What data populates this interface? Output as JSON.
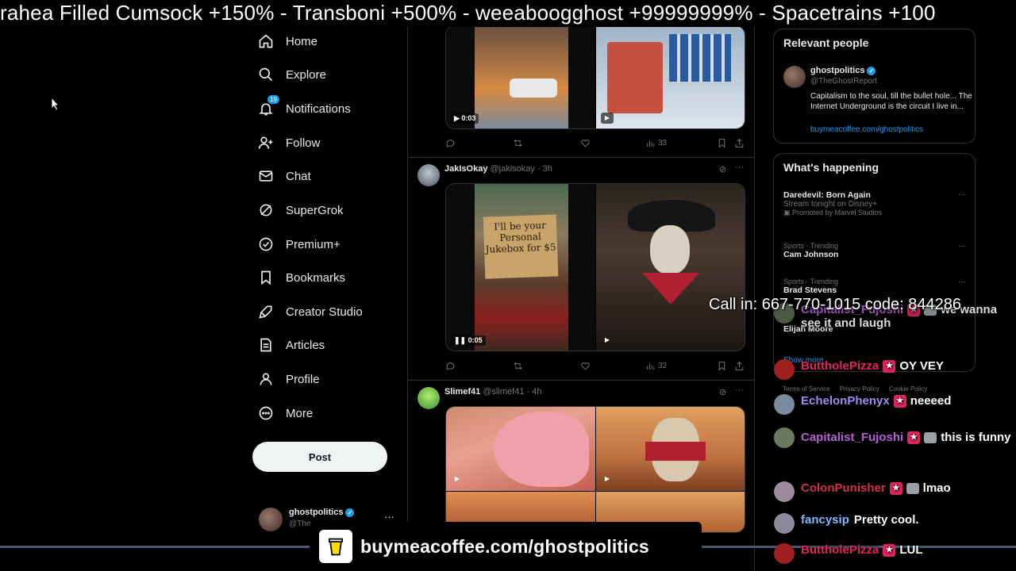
{
  "ticker": {
    "text": "rahea Filled Cumsock +150%  -  Transboni +500%  -  weeaboogghost +99999999%  -  Spacetrains +100"
  },
  "nav": {
    "items": [
      {
        "label": "Home",
        "icon": "home-icon"
      },
      {
        "label": "Explore",
        "icon": "search-icon"
      },
      {
        "label": "Notifications",
        "icon": "bell-icon",
        "badge": "19"
      },
      {
        "label": "Follow",
        "icon": "person-add-icon"
      },
      {
        "label": "Chat",
        "icon": "envelope-icon"
      },
      {
        "label": "SuperGrok",
        "icon": "grok-icon"
      },
      {
        "label": "Premium+",
        "icon": "verified-icon"
      },
      {
        "label": "Bookmarks",
        "icon": "bookmark-icon"
      },
      {
        "label": "Creator Studio",
        "icon": "rocket-icon"
      },
      {
        "label": "Articles",
        "icon": "document-icon"
      },
      {
        "label": "Profile",
        "icon": "person-icon"
      },
      {
        "label": "More",
        "icon": "more-circle-icon"
      }
    ],
    "post_label": "Post"
  },
  "account": {
    "name": "ghostpolitics",
    "handle": "@The",
    "more": "···"
  },
  "feed": {
    "tweets": [
      {
        "video_time": "0:03",
        "actions": {
          "views": "33"
        }
      },
      {
        "name": "JakIsOkay",
        "meta": "@jakisokay · 3h",
        "sign_text": "I'll be your Personal Jukebox for $5",
        "video_time": "0:05",
        "actions": {
          "views": "32"
        }
      },
      {
        "name": "Slimef41",
        "meta": "@slimef41 · 4h"
      }
    ]
  },
  "relevant": {
    "title": "Relevant people",
    "name": "ghostpolitics",
    "handle": "@TheGhostReport",
    "bio": "Capitalism to the soul, till the bullet hole... The Internet Underground is the circuit I live in...",
    "link": "buymeacoffee.com/ghostpolitics"
  },
  "happening": {
    "title": "What's happening",
    "trends": [
      {
        "title": "Daredevil: Born Again",
        "sub": "Stream tonight on Disney+",
        "promo": "Promoted by Marvel Studios"
      },
      {
        "context": "Sports · Trending",
        "title": "Cam Johnson"
      },
      {
        "context": "Sports · Trending",
        "title": "Brad Stevens"
      },
      {
        "title": "Elijah Moore"
      }
    ],
    "show_more": "Show more"
  },
  "footer": [
    "Terms of Service",
    "Privacy Policy",
    "Cookie Policy"
  ],
  "overlay": {
    "callin": "Call in: 667-770-1015 code: 844286",
    "chat": [
      {
        "user": "Capitalist_Fujoshi",
        "color": "#b65fd3",
        "text": "we wanna see it and laugh",
        "partial": true
      },
      {
        "user": "ButtholePizza",
        "color": "#e0245e",
        "text": "OY VEY"
      },
      {
        "user": "EchelonPhenyx",
        "color": "#9b8cf0",
        "text": "neeeed"
      },
      {
        "user": "Capitalist_Fujoshi",
        "color": "#b65fd3",
        "text": "this is funny"
      },
      {
        "user": "ColonPunisher",
        "color": "#d0304a",
        "text": "lmao"
      },
      {
        "user": "fancysip",
        "color": "#7fb8ff",
        "text": "Pretty cool."
      },
      {
        "user": "ButtholePizza",
        "color": "#e0245e",
        "text": "LUL"
      }
    ],
    "coffee": "buymeacoffee.com/ghostpolitics"
  }
}
